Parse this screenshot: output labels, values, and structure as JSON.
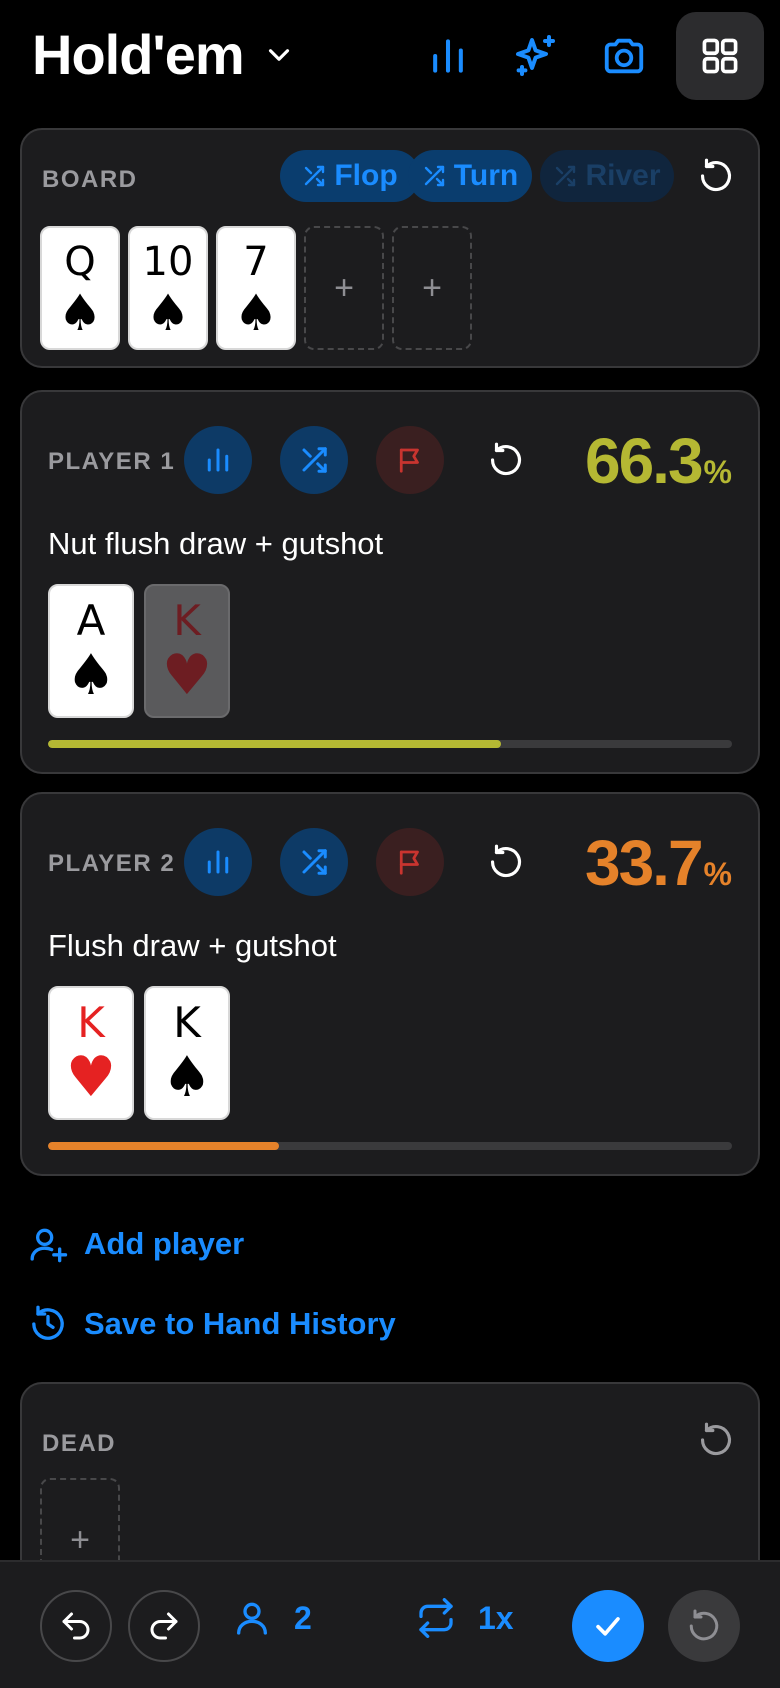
{
  "header": {
    "title": "Hold'em",
    "icons": [
      "chevron-down-icon",
      "bar-chart-icon",
      "sparkles-icon",
      "camera-icon",
      "grid-icon"
    ]
  },
  "board": {
    "label": "BOARD",
    "streets": [
      {
        "label": "Flop",
        "enabled": true
      },
      {
        "label": "Turn",
        "enabled": true
      },
      {
        "label": "River",
        "enabled": false
      }
    ],
    "cards": [
      {
        "rank": "Q",
        "suit": "♠",
        "color": "black"
      },
      {
        "rank": "10",
        "suit": "♠",
        "color": "black"
      },
      {
        "rank": "7",
        "suit": "♠",
        "color": "black"
      }
    ],
    "empty_slot": "+"
  },
  "players": [
    {
      "label": "PLAYER 1",
      "equity": "66.3",
      "equity_fraction": 0.663,
      "pct_sign": "%",
      "color": "#b5b833",
      "description": "Nut flush draw + gutshot",
      "cards": [
        {
          "rank": "A",
          "suit": "♠",
          "state": "normal"
        },
        {
          "rank": "K",
          "suit": "♥",
          "state": "used"
        }
      ]
    },
    {
      "label": "PLAYER 2",
      "equity": "33.7",
      "equity_fraction": 0.337,
      "pct_sign": "%",
      "color": "#e5822a",
      "description": "Flush draw + gutshot",
      "cards": [
        {
          "rank": "K",
          "suit": "♥",
          "state": "red"
        },
        {
          "rank": "K",
          "suit": "♠",
          "state": "normal"
        }
      ]
    }
  ],
  "actions": {
    "add_player": "Add player",
    "save_history": "Save to Hand History"
  },
  "dead": {
    "label": "DEAD",
    "empty_slot": "+"
  },
  "bottom_bar": {
    "player_count": "2",
    "iterations": "1x"
  },
  "colors": {
    "accent": "#1a8cff",
    "background": "#000000",
    "panel": "#1c1c1e",
    "player1": "#b5b833",
    "player2": "#e5822a"
  }
}
